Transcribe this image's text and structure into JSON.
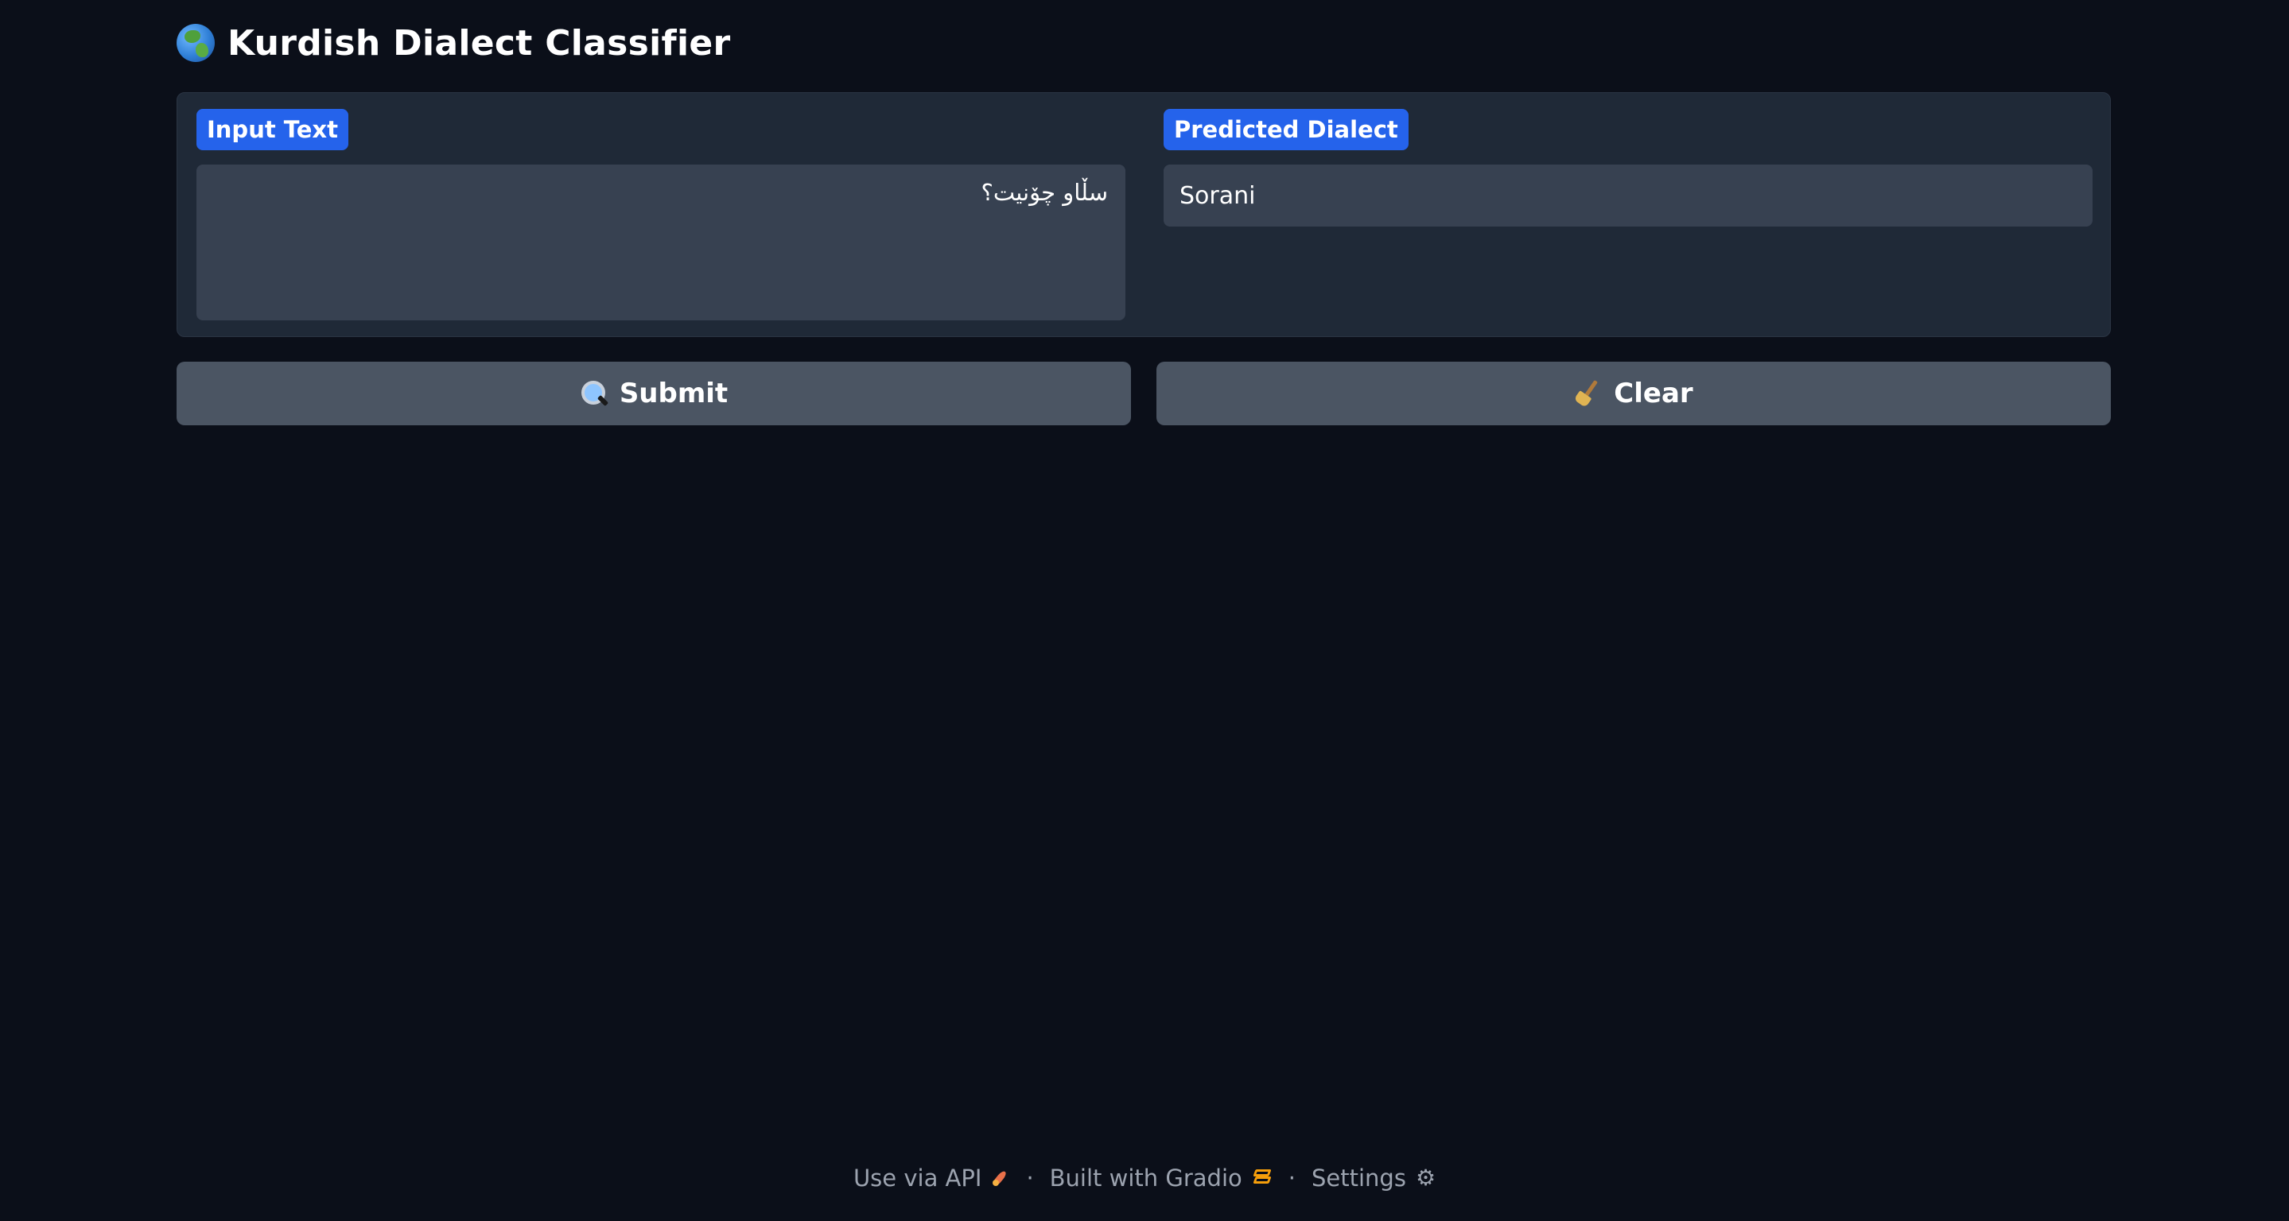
{
  "app": {
    "title": "Kurdish Dialect Classifier",
    "title_icon": "globe-icon"
  },
  "input": {
    "label": "Input Text",
    "value": "سڵاو چۆنیت؟"
  },
  "output": {
    "label": "Predicted Dialect",
    "value": "Sorani"
  },
  "buttons": {
    "submit_label": "Submit",
    "submit_icon": "magnifier-icon",
    "clear_label": "Clear",
    "clear_icon": "broom-icon"
  },
  "footer": {
    "api_label": "Use via API",
    "api_icon": "rocket-icon",
    "built_label": "Built with Gradio",
    "built_icon": "gradio-logo-icon",
    "settings_label": "Settings",
    "settings_icon": "gear-icon",
    "separator": "·"
  },
  "colors": {
    "background": "#0b0f19",
    "panel": "#1f2937",
    "field": "#374151",
    "button": "#4b5563",
    "label_chip": "#2563eb",
    "footer_text": "#9ca3af",
    "gradio_accent": "#f59e0b"
  }
}
